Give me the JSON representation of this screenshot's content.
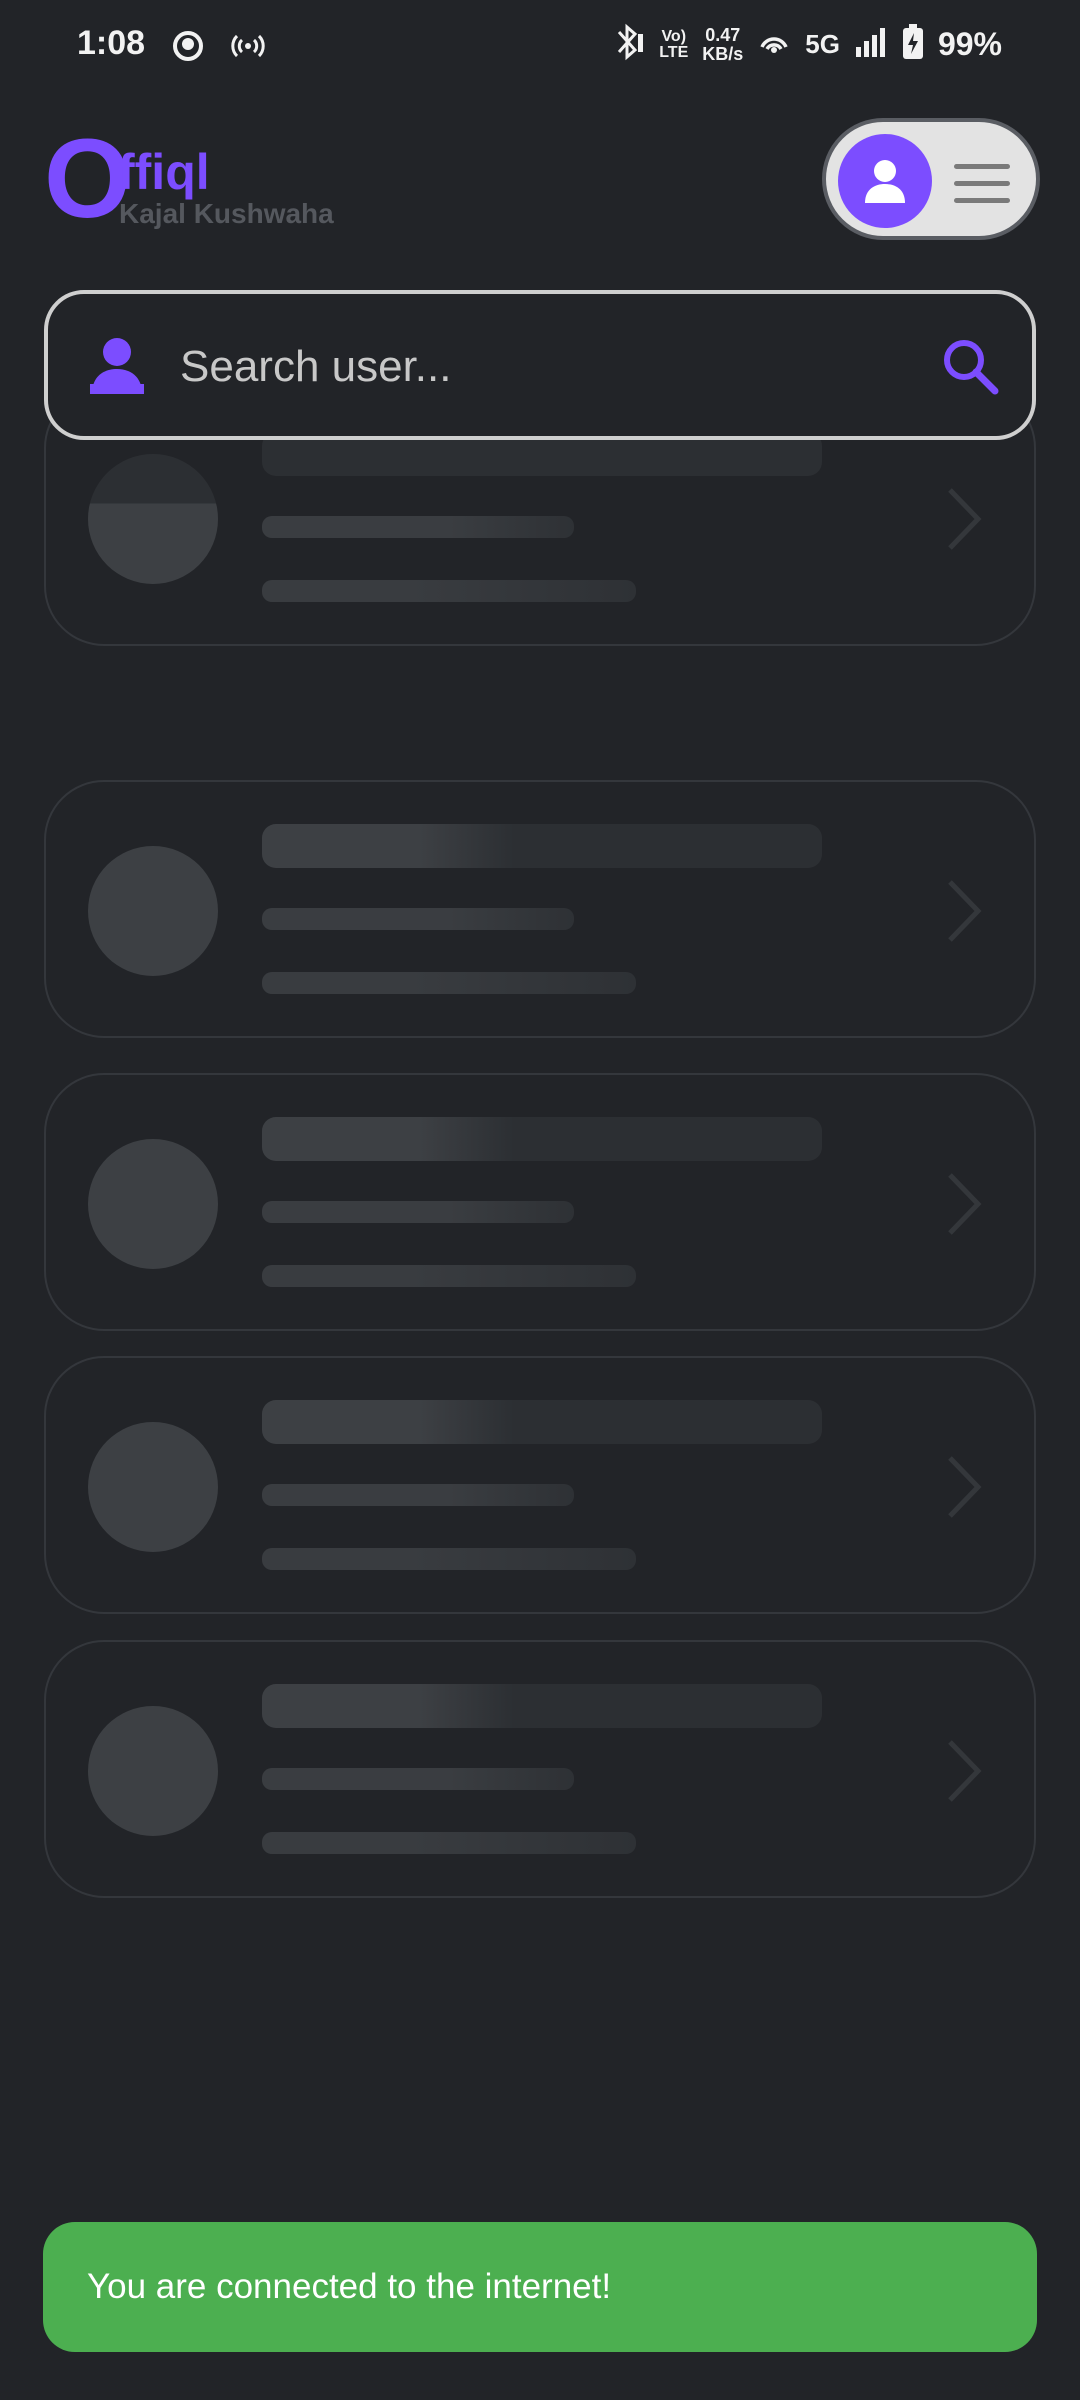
{
  "status_bar": {
    "time": "1:08",
    "volte_line1": "Vo)",
    "volte_line2": "LTE",
    "speed_value": "0.47",
    "speed_unit": "KB/s",
    "network": "5G",
    "battery": "99%"
  },
  "header": {
    "logo_initial": "O",
    "logo_rest": "ffiql",
    "username": "Kajal Kushwaha"
  },
  "search": {
    "placeholder": "Search user..."
  },
  "skeleton_cards_count": 5,
  "snackbar": {
    "message": "You are connected to the internet!"
  },
  "colors": {
    "background": "#222428",
    "accent": "#7c4dff",
    "snackbar": "#4caf50",
    "skeleton": "#3d4044"
  },
  "icons": [
    "notification-app-icon",
    "hotspot-icon",
    "bluetooth-icon",
    "wifi-icon",
    "signal-icon",
    "battery-charging-icon",
    "user-icon",
    "menu-icon",
    "search-icon",
    "chevron-right-icon"
  ]
}
